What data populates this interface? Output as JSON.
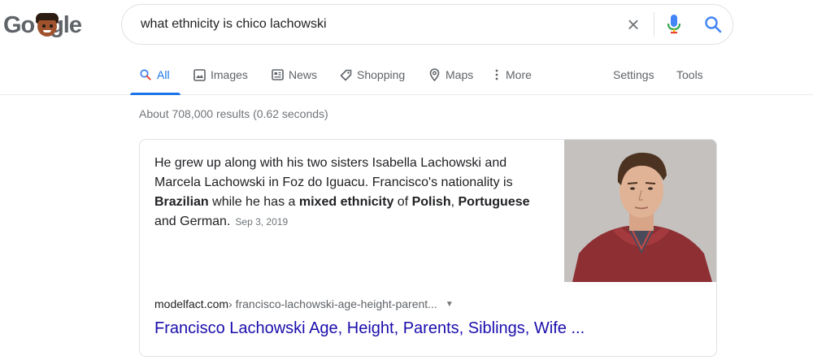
{
  "logo": {
    "text_left": "Go",
    "text_right": "gle"
  },
  "search": {
    "query": "what ethnicity is chico lachowski",
    "clear_glyph": "×"
  },
  "tabs": [
    {
      "label": "All",
      "icon": "search-icon",
      "active": true
    },
    {
      "label": "Images",
      "icon": "image-icon"
    },
    {
      "label": "News",
      "icon": "news-icon"
    },
    {
      "label": "Shopping",
      "icon": "tag-icon"
    },
    {
      "label": "Maps",
      "icon": "map-pin-icon"
    },
    {
      "label": "More",
      "icon": "more-vert-icon"
    }
  ],
  "tools": {
    "settings": "Settings",
    "tools": "Tools"
  },
  "stats": "About 708,000 results (0.62 seconds)",
  "featured": {
    "s1": "He grew up along with his two sisters Isabella Lachowski and Marcela Lachowski in Foz do Iguacu. Francisco's nationality is ",
    "b1": "Brazilian",
    "s2": " while he has a ",
    "b2": "mixed ethnicity",
    "s3": " of ",
    "b3": "Polish",
    "s4": ", ",
    "b4": "Portuguese",
    "s5": " and German.",
    "date": "Sep 3, 2019",
    "source_domain": "modelfact.com",
    "source_path": " › francisco-lachowski-age-height-parent...",
    "caret": "▼",
    "title": "Francisco Lachowski Age, Height, Parents, Siblings, Wife ..."
  },
  "colors": {
    "accent": "#1a73e8",
    "link": "#1a0dab"
  }
}
